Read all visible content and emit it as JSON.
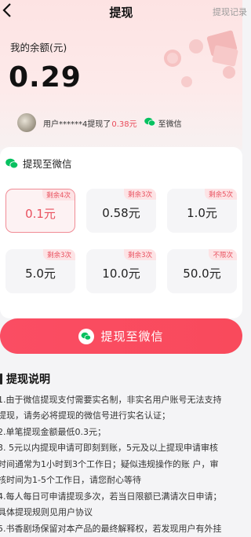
{
  "header": {
    "back_icon": "chevron-left-icon",
    "title": "提现",
    "records_label": "提现记录"
  },
  "balance": {
    "label": "我的余额(元)",
    "amount": "0.29"
  },
  "ticker": {
    "prefix": "用户******4提现了",
    "amount": "0.38元",
    "suffix": "至微信"
  },
  "options_card": {
    "title": "提现至微信",
    "options": [
      {
        "amount": "0.1元",
        "tag": "剩余4次",
        "selected": true
      },
      {
        "amount": "0.58元",
        "tag": "剩余3次",
        "selected": false
      },
      {
        "amount": "1.0元",
        "tag": "剩余5次",
        "selected": false
      },
      {
        "amount": "5.0元",
        "tag": "剩余3次",
        "selected": false
      },
      {
        "amount": "10.0元",
        "tag": "剩余3次",
        "selected": false
      },
      {
        "amount": "50.0元",
        "tag": "不限次",
        "selected": false
      }
    ]
  },
  "withdraw_button": {
    "label": "提现至微信"
  },
  "description": {
    "title": "提现说明",
    "lines": [
      "1.由于微信提现支付需要实名制，非实名用户账号无法支持",
      "提现，请务必将提现的微信号进行实名认证；",
      "2.单笔提现金额最低0.3元；",
      "3. 5元以内提现申请可即刻到账，5元及以上提现申请审核",
      "时间通常为1小时到3个工作日；疑似违规操作的账 户，审",
      "核时间为1-5个工作日，请您耐心等待",
      "4.每人每日可申请提现多次，若当日限额已满请次日申请；",
      "具体提现规则见用户协议",
      "5.书香剧场保留对本产品的最终解释权，若发现用户有外挂"
    ]
  },
  "colors": {
    "accent": "#f94a5c",
    "wechat": "#07c160",
    "hero_bg": "#fde3e3"
  }
}
